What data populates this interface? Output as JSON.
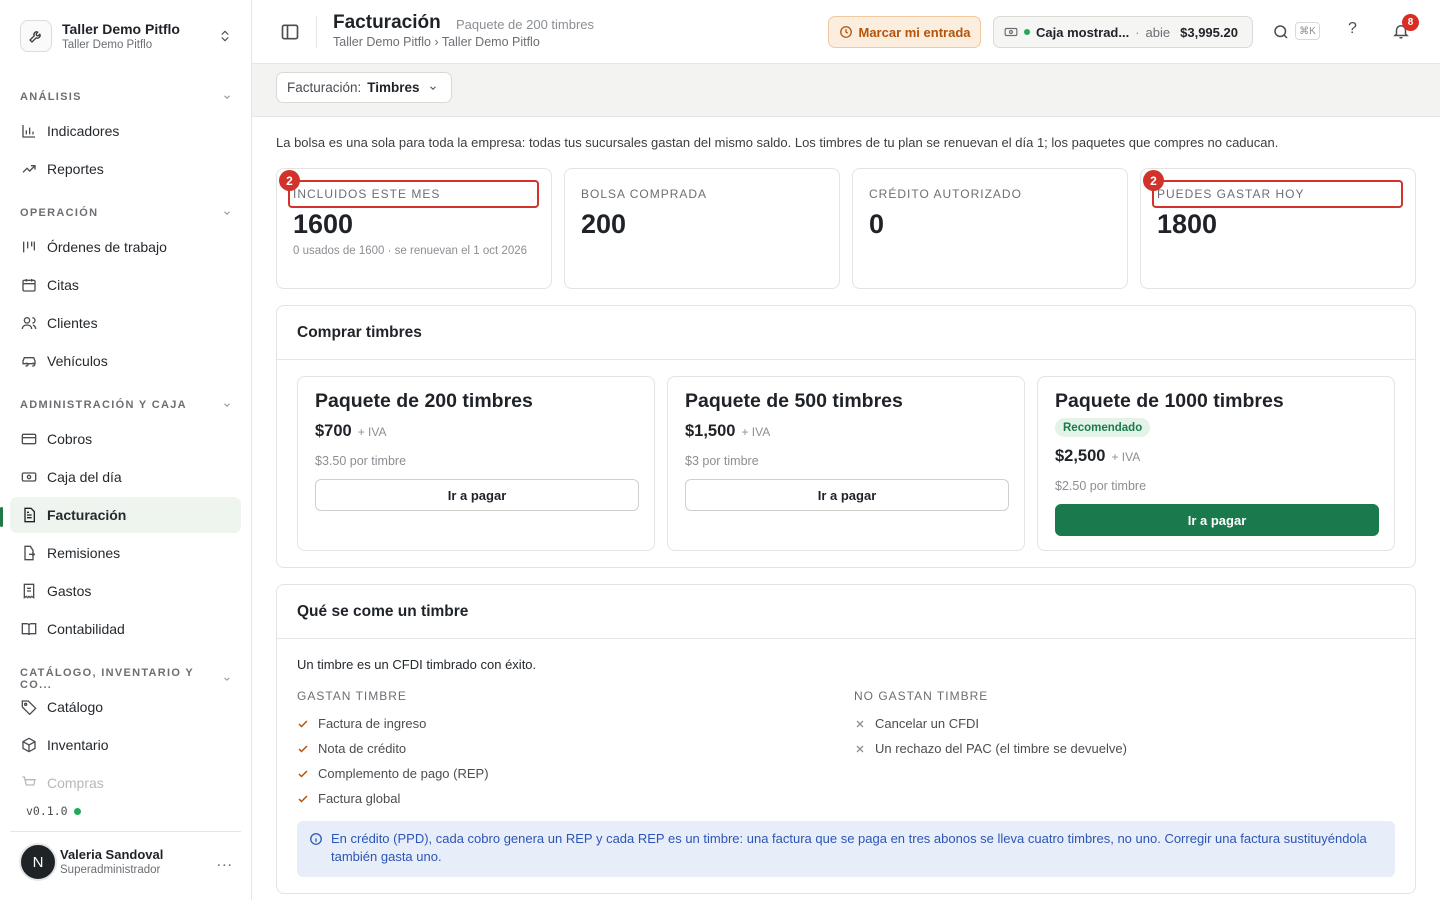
{
  "org": {
    "name": "Taller Demo Pitflo",
    "sub": "Taller Demo Pitflo"
  },
  "sidebar": {
    "sections": [
      {
        "title": "ANÁLISIS",
        "items": [
          "Indicadores",
          "Reportes"
        ]
      },
      {
        "title": "OPERACIÓN",
        "items": [
          "Órdenes de trabajo",
          "Citas",
          "Clientes",
          "Vehículos"
        ]
      },
      {
        "title": "ADMINISTRACIÓN Y CAJA",
        "items": [
          "Cobros",
          "Caja del día",
          "Facturación",
          "Remisiones",
          "Gastos",
          "Contabilidad"
        ]
      },
      {
        "title": "CATÁLOGO, INVENTARIO Y CO...",
        "items": [
          "Catálogo",
          "Inventario",
          "Compras"
        ]
      }
    ],
    "active_item": "Facturación",
    "version": "v0.1.0"
  },
  "user": {
    "initial": "N",
    "name": "Valeria Sandoval",
    "role": "Superadministrador",
    "more": "..."
  },
  "header": {
    "title": "Facturación",
    "subtitle": "Paquete de 200 timbres",
    "breadcrumb": "Taller Demo Pitflo › Taller Demo Pitflo",
    "entrada_label": "Marcar mi entrada",
    "caja": {
      "name": "Caja mostrad...",
      "sep": "·",
      "state": "abie",
      "amount": "$3,995.20"
    },
    "kbd": "⌘K",
    "help": "?",
    "notifications": "8"
  },
  "filter": {
    "label": "Facturación:",
    "value": "Timbres"
  },
  "intro": "La bolsa es una sola para toda la empresa: todas tus sucursales gastan del mismo saldo. Los timbres de tu plan se renuevan el día 1; los paquetes que compres no caducan.",
  "stats": [
    {
      "label": "INCLUIDOS ESTE MES",
      "value": "1600",
      "sub": "0 usados de 1600 · se renuevan el 1 oct 2026",
      "marker": "2"
    },
    {
      "label": "BOLSA COMPRADA",
      "value": "200",
      "sub": ""
    },
    {
      "label": "CRÉDITO AUTORIZADO",
      "value": "0",
      "sub": ""
    },
    {
      "label": "PUEDES GASTAR HOY",
      "value": "1800",
      "sub": "",
      "marker": "2"
    }
  ],
  "buy": {
    "title": "Comprar timbres",
    "packages": [
      {
        "title": "Paquete de 200 timbres",
        "price": "$700",
        "iva": "+ IVA",
        "per": "$3.50 por timbre",
        "button": "Ir a pagar"
      },
      {
        "title": "Paquete de 500 timbres",
        "price": "$1,500",
        "iva": "+ IVA",
        "per": "$3 por timbre",
        "button": "Ir a pagar"
      },
      {
        "title": "Paquete de 1000 timbres",
        "badge": "Recomendado",
        "price": "$2,500",
        "iva": "+ IVA",
        "per": "$2.50 por timbre",
        "button": "Ir a pagar"
      }
    ]
  },
  "eat": {
    "title": "Qué se come un timbre",
    "intro": "Un timbre es un CFDI timbrado con éxito.",
    "spend_title": "GASTAN TIMBRE",
    "spend": [
      "Factura de ingreso",
      "Nota de crédito",
      "Complemento de pago (REP)",
      "Factura global"
    ],
    "nospend_title": "NO GASTAN TIMBRE",
    "nospend": [
      "Cancelar un CFDI",
      "Un rechazo del PAC (el timbre se devuelve)"
    ],
    "note": "En crédito (PPD), cada cobro genera un REP y cada REP es un timbre: una factura que se paga en tres abonos se lleva cuatro timbres, no uno. Corregir una factura sustituyéndola también gasta uno."
  },
  "colors": {
    "accent": "#1b7a4d",
    "highlight": "#d1322a",
    "warning": "#b45309",
    "info": "#2c55b5"
  }
}
